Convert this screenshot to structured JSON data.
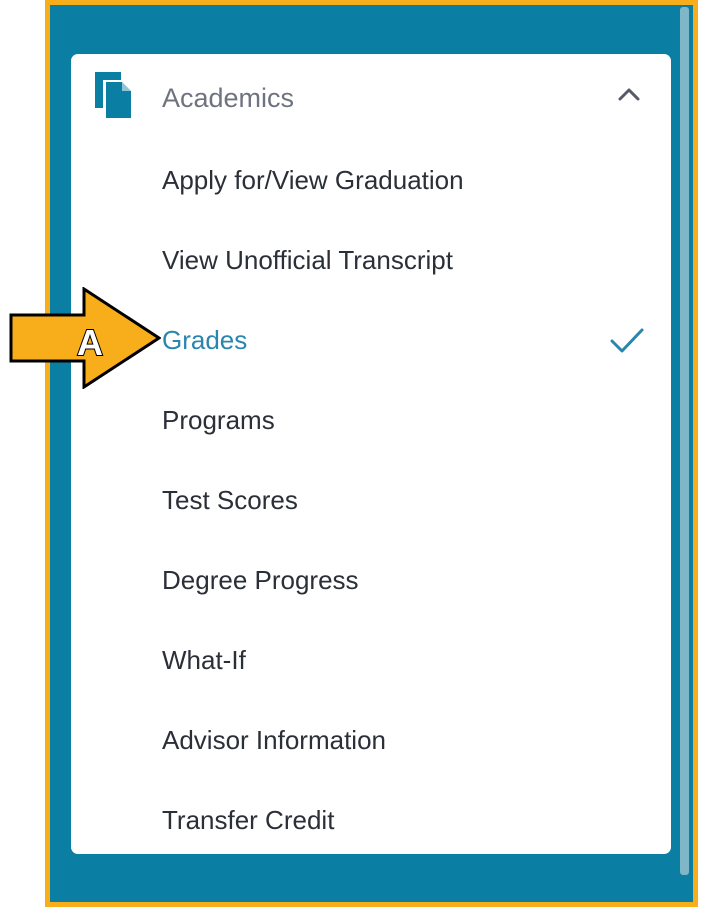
{
  "colors": {
    "frame_border": "#f7ae1a",
    "panel_background": "#0b7ea3",
    "accent": "#2a86ad",
    "text": "#2b2f38",
    "muted_text": "#6f7380",
    "callout_fill": "#f7ae1a"
  },
  "menu": {
    "header": {
      "label": "Academics",
      "icon": "documents-icon",
      "toggle_icon": "chevron-up-icon",
      "expanded": true
    },
    "items": [
      {
        "label": "Apply for/View Graduation",
        "active": false
      },
      {
        "label": "View Unofficial Transcript",
        "active": false
      },
      {
        "label": "Grades",
        "active": true,
        "indicator_icon": "checkmark-icon"
      },
      {
        "label": "Programs",
        "active": false
      },
      {
        "label": "Test Scores",
        "active": false
      },
      {
        "label": "Degree Progress",
        "active": false
      },
      {
        "label": "What-If",
        "active": false
      },
      {
        "label": "Advisor Information",
        "active": false
      },
      {
        "label": "Transfer Credit",
        "active": false
      }
    ]
  },
  "callout": {
    "label": "A",
    "icon": "arrow-right-icon"
  }
}
